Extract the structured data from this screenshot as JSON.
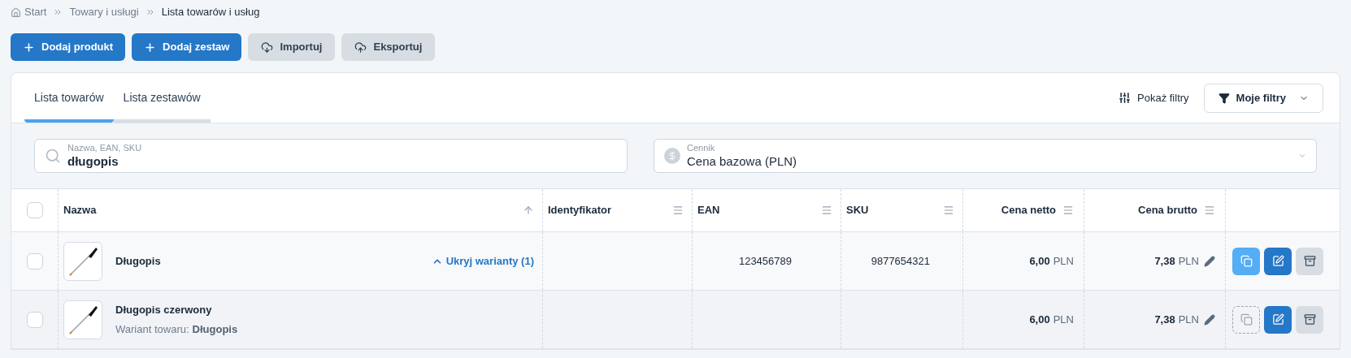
{
  "breadcrumb": [
    {
      "label": "Start",
      "kind": "home"
    },
    {
      "label": "Towary i usługi",
      "kind": "link"
    },
    {
      "label": "Lista towarów i usług",
      "kind": "current"
    }
  ],
  "actions": [
    {
      "label": "Dodaj produkt",
      "kind": "add"
    },
    {
      "label": "Dodaj zestaw",
      "kind": "add"
    },
    {
      "label": "Importuj",
      "kind": "import"
    },
    {
      "label": "Eksportuj",
      "kind": "export"
    }
  ],
  "tabs": [
    {
      "label": "Lista towarów",
      "selected": true
    },
    {
      "label": "Lista zestawów",
      "selected": false
    }
  ],
  "show_filters": "Pokaż filtry",
  "my_filters": "Moje filtry",
  "search": {
    "label": "Nazwa, EAN, SKU",
    "value": "długopis"
  },
  "price_list": {
    "label": "Cennik",
    "value": "Cena bazowa (PLN)"
  },
  "table": {
    "select_all": {
      "checked": false
    },
    "columns": [
      {
        "label": "Nazwa",
        "kind": "sortable"
      },
      {
        "label": "Identyfikator",
        "kind": "menu"
      },
      {
        "label": "EAN",
        "kind": "menu"
      },
      {
        "label": "SKU",
        "kind": "menu"
      },
      {
        "label": "Cena netto",
        "kind": "menu"
      },
      {
        "label": "Cena brutto",
        "kind": "menu"
      }
    ],
    "rows": [
      {
        "kind": "product",
        "name": "Długopis",
        "toggle": "Ukryj warianty (1)",
        "checked": false,
        "ean": "123456789",
        "sku": "9877654321",
        "net": "6,00",
        "net_currency": "PLN",
        "gross": "7,38",
        "gross_currency": "PLN",
        "copy_disabled": false
      },
      {
        "kind": "variant",
        "name": "Długopis czerwony",
        "variant_label": "Wariant towaru:",
        "variant_parent": "Długopis",
        "checked": false,
        "net": "6,00",
        "net_currency": "PLN",
        "gross": "7,38",
        "gross_currency": "PLN",
        "copy_disabled": true
      }
    ]
  }
}
